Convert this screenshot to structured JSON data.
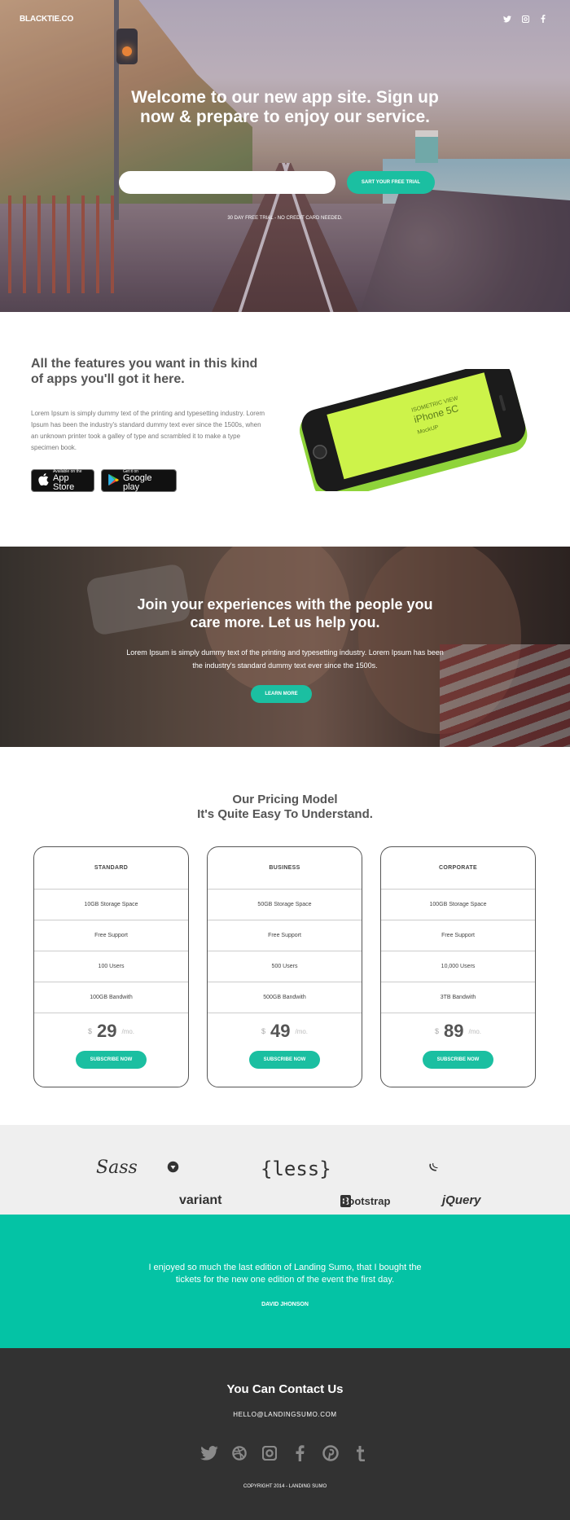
{
  "header": {
    "logo": "BLACKTIE.CO",
    "social_icons": [
      "twitter-icon",
      "instagram-icon",
      "facebook-icon"
    ]
  },
  "hero": {
    "title": "Welcome to our new app site. Sign up now & prepare to enjoy our service.",
    "input_placeholder": "",
    "cta_label": "SART YOUR FREE TRIAL",
    "note": "30 DAY FREE TRIAL - NO CREDIT CARD NEEDED."
  },
  "features": {
    "title": "All the features you want in this kind of apps you'll got it here.",
    "text": "Lorem Ipsum is simply dummy text of the printing and typesetting industry. Lorem Ipsum has been the industry's standard dummy text ever since the 1500s, when an unknown printer took a galley of type and scrambled it to make a type specimen book.",
    "app_store": {
      "small": "Available on the",
      "big": "App Store"
    },
    "google_play": {
      "small": "Get it on",
      "big": "Google play"
    },
    "phone_screen": {
      "line1": "ISOMETRIC VIEW",
      "line2": "iPhone 5C",
      "line3": "MockUP"
    }
  },
  "friends": {
    "title": "Join your experiences with the people you care more. Let us help you.",
    "text": "Lorem Ipsum is simply dummy text of the printing and typesetting industry. Lorem Ipsum has been the industry's standard dummy text ever since the 1500s.",
    "button": "LEARN MORE"
  },
  "pricing": {
    "title_line1": "Our Pricing Model",
    "title_line2": "It's Quite Easy To Understand.",
    "plans": [
      {
        "name": "STANDARD",
        "storage": "10GB Storage Space",
        "support": "Free Support",
        "users": "100 Users",
        "bandwidth": "100GB Bandwith",
        "currency": "$",
        "price": "29",
        "period": "/mo.",
        "button": "SUBSCRIBE NOW"
      },
      {
        "name": "BUSINESS",
        "storage": "50GB Storage Space",
        "support": "Free Support",
        "users": "500 Users",
        "bandwidth": "500GB Bandwith",
        "currency": "$",
        "price": "49",
        "period": "/mo.",
        "button": "SUBSCRIBE NOW"
      },
      {
        "name": "CORPORATE",
        "storage": "100GB Storage Space",
        "support": "Free Support",
        "users": "10,000 Users",
        "bandwidth": "3TB Bandwith",
        "currency": "$",
        "price": "89",
        "period": "/mo.",
        "button": "SUBSCRIBE NOW"
      }
    ]
  },
  "tech": {
    "sass": "Sass",
    "variant": "variant",
    "less": "{less}",
    "bootstrap": "Bootstrap",
    "jquery": "jQuery"
  },
  "testimonial": {
    "quote": "I enjoyed so much the last edition of Landing Sumo, that I bought the tickets for the new one edition of the event the first day.",
    "author": "DAVID JHONSON"
  },
  "footer": {
    "title": "You Can Contact Us",
    "email": "HELLO@LANDINGSUMO.COM",
    "social_icons": [
      "twitter-icon",
      "dribbble-icon",
      "instagram-icon",
      "facebook-icon",
      "pinterest-icon",
      "tumblr-icon"
    ],
    "copyright": "COPYRIGHT 2014 - LANDING SUMO"
  },
  "colors": {
    "accent": "#1bbfa1",
    "testimonial_bg": "#04c3a5",
    "footer_bg": "#323232",
    "tech_bg": "#efefef"
  }
}
